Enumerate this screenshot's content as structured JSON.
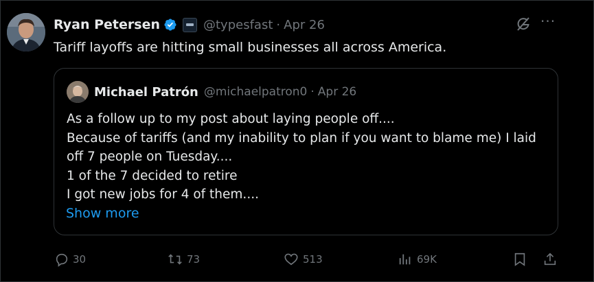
{
  "author": {
    "name": "Ryan Petersen",
    "handle": "@typesfast",
    "date": "Apr 26",
    "separator": "·"
  },
  "tweet": {
    "text": "Tariff layoffs are hitting small businesses all across America."
  },
  "quote": {
    "name": "Michael Patrón",
    "handle": "@michaelpatron0",
    "date": "Apr 26",
    "separator": "·",
    "lines": [
      "As a follow up to my post about laying people off....",
      "Because of tariffs (and my inability to plan if you want to blame me) I laid",
      "off 7 people on Tuesday....",
      "1 of the 7 decided to retire",
      "I got new jobs for 4 of them...."
    ],
    "show_more": "Show more"
  },
  "actions": {
    "replies": "30",
    "reposts": "73",
    "likes": "513",
    "views": "69K"
  },
  "more_label": "···",
  "colors": {
    "background": "#000000",
    "text": "#e7e9ea",
    "muted": "#71767b",
    "accent": "#1d9bf0",
    "border": "#2f3336"
  },
  "icons": [
    "verified-badge-icon",
    "affiliation-badge-icon",
    "grok-icon",
    "more-icon",
    "reply-icon",
    "repost-icon",
    "like-icon",
    "views-icon",
    "bookmark-icon",
    "share-icon"
  ]
}
